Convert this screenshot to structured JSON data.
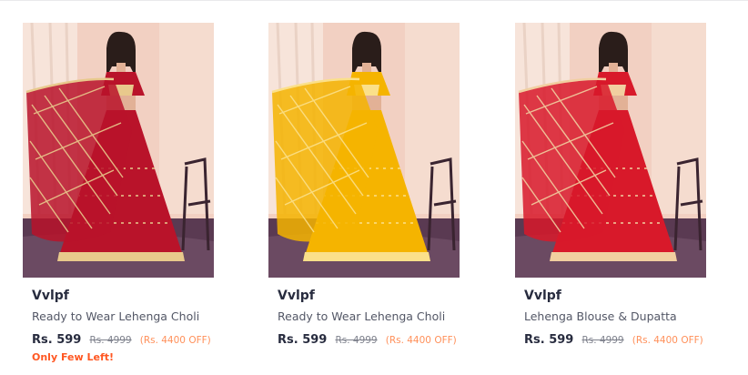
{
  "products": [
    {
      "brand": "Vvlpf",
      "title": "Ready to Wear Lehenga Choli",
      "price": "Rs. 599",
      "mrp": "Rs. 4999",
      "discount": "(Rs. 4400 OFF)",
      "stock_note": "Only Few Left!",
      "garment_color": "#b9132a",
      "garment_accent": "#e8c98c"
    },
    {
      "brand": "Vvlpf",
      "title": "Ready to Wear Lehenga Choli",
      "price": "Rs. 599",
      "mrp": "Rs. 4999",
      "discount": "(Rs. 4400 OFF)",
      "stock_note": "",
      "garment_color": "#f5b400",
      "garment_accent": "#fbe08a"
    },
    {
      "brand": "Vvlpf",
      "title": "Lehenga Blouse & Dupatta",
      "price": "Rs. 599",
      "mrp": "Rs. 4999",
      "discount": "(Rs. 4400 OFF)",
      "stock_note": "",
      "garment_color": "#d8192a",
      "garment_accent": "#f1cfa0"
    }
  ]
}
